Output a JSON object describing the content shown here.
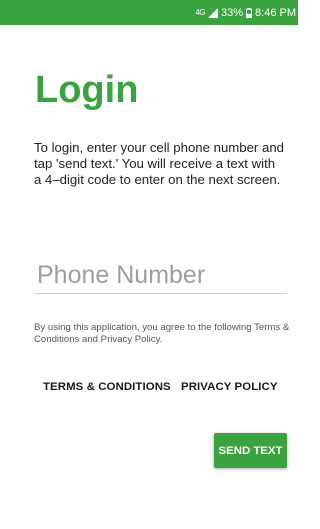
{
  "status_bar": {
    "network_label": "4G",
    "battery_text": "33%",
    "time": "8:46 PM",
    "icons": [
      "lte-icon",
      "signal-icon",
      "battery-icon"
    ],
    "background_color": "#3aa33f"
  },
  "login": {
    "title": "Login",
    "instructions": "To login, enter your cell phone number and tap 'send text.' You will receive a text with a 4–digit code to enter on the next screen.",
    "phone_placeholder": "Phone Number",
    "phone_value": "",
    "agreement_text": "By using this application, you agree to the following Terms & Conditions and Privacy Policy.",
    "terms_label": "TERMS & CONDITIONS",
    "privacy_label": "PRIVACY POLICY",
    "send_label": "SEND TEXT"
  },
  "colors": {
    "accent": "#3aa33f",
    "text": "#222222"
  }
}
